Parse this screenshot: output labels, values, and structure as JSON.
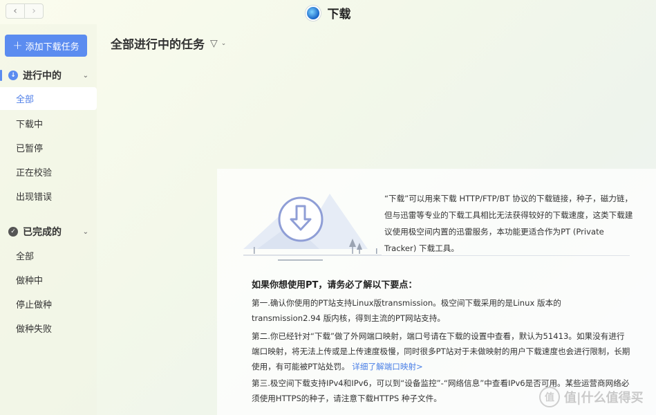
{
  "window": {
    "title": "下载",
    "back_icon": "‹",
    "forward_icon": "›"
  },
  "sidebar": {
    "add_button_label": "添加下载任务",
    "add_button_icon": "+",
    "groups": [
      {
        "label": "进行中的",
        "icon_color": "#5b8cf0",
        "items": [
          {
            "label": "全部",
            "active": true
          },
          {
            "label": "下载中"
          },
          {
            "label": "已暂停"
          },
          {
            "label": "正在校验"
          },
          {
            "label": "出现错误"
          }
        ]
      },
      {
        "label": "已完成的",
        "icon_color": "#555555",
        "items": [
          {
            "label": "全部"
          },
          {
            "label": "做种中"
          },
          {
            "label": "停止做种"
          },
          {
            "label": "做种失败"
          }
        ]
      }
    ]
  },
  "main": {
    "title": "全部进行中的任务",
    "intro_text": "“下载”可以用来下载 HTTP/FTP/BT 协议的下载链接，种子，磁力链，但与迅雷等专业的下载工具相比无法获得较好的下载速度，这类下载建议使用极空间内置的迅雷服务，本功能更适合作为PT (Private Tracker) 下载工具。",
    "tips_title": "如果你想使用PT，请务必了解以下要点：",
    "tip1": "第一.确认你使用的PT站支持Linux版transmission。极空间下载采用的是Linux 版本的 transmission2.94 版内核，得到主流的PT网站支持。",
    "tip2": "第二.你已经针对“下载”做了外网端口映射，端口号请在下载的设置中查看，默认为51413。如果没有进行端口映射，将无法上传或是上传速度极慢，同时很多PT站对于未做映射的用户下载速度也会进行限制，长期使用，有可能被PT站处罚。",
    "tip2_link": "详细了解端口映射>",
    "tip3": "第三.极空间下载支持IPv4和IPv6，可以到“设备监控”-“网络信息”中查看IPv6是否可用。某些运营商网络必须使用HTTPS的种子，请注意下载HTTPS 种子文件。"
  },
  "watermark": {
    "text": "值|什么值得买",
    "logo": "值"
  },
  "colors": {
    "accent": "#5b8cf0",
    "link": "#4a7fe6"
  }
}
